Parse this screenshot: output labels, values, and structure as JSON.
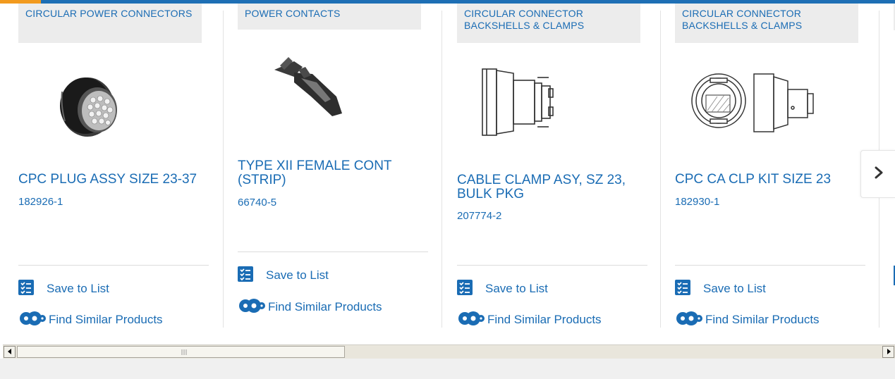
{
  "colors": {
    "accent": "#1a6cb4",
    "top_bar": "#1e6fb5",
    "top_bar_highlight": "#f29a1e",
    "category_bg": "#ececec"
  },
  "cards": [
    {
      "category": "CIRCULAR POWER CONNECTORS",
      "image_icon": "cpc-plug-photo",
      "title": "CPC PLUG ASSY SIZE 23-37",
      "part_number": "182926-1",
      "save_label": "Save to List",
      "similar_label": "Find Similar Products"
    },
    {
      "category": "POWER CONTACTS",
      "image_icon": "female-contact-photo",
      "title": "TYPE XII FEMALE CONT (STRIP)",
      "part_number": "66740-5",
      "save_label": "Save to List",
      "similar_label": "Find Similar Products"
    },
    {
      "category": "CIRCULAR CONNECTOR BACKSHELLS & CLAMPS",
      "image_icon": "cable-clamp-drawing",
      "title": "CABLE CLAMP ASY, SZ 23, BULK PKG",
      "part_number": "207774-2",
      "save_label": "Save to List",
      "similar_label": "Find Similar Products"
    },
    {
      "category": "CIRCULAR CONNECTOR BACKSHELLS & CLAMPS",
      "image_icon": "clamp-kit-drawing",
      "title": "CPC CA CLP KIT SIZE 23",
      "part_number": "182930-1",
      "save_label": "Save to List",
      "similar_label": "Find Similar Products"
    }
  ],
  "next_button": {
    "icon": "chevron-right-icon"
  },
  "scrollbar": {
    "left_icon": "arrow-left-icon",
    "right_icon": "arrow-right-icon"
  }
}
